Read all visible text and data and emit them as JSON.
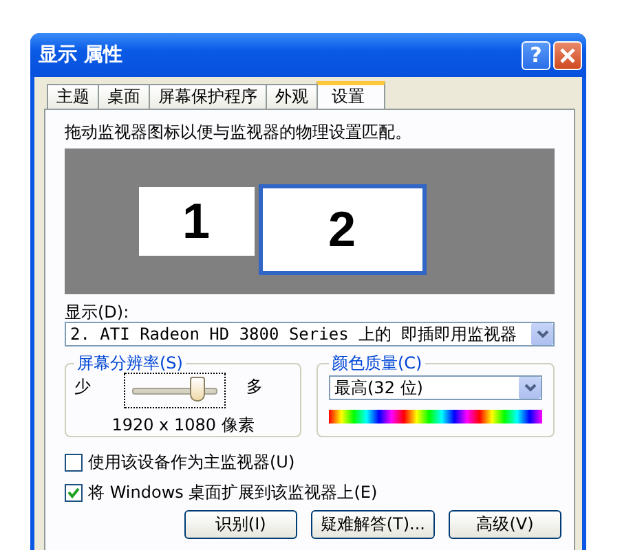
{
  "window": {
    "title": "显示 属性",
    "help": "?"
  },
  "tabs": [
    {
      "label": "主题",
      "selected": false
    },
    {
      "label": "桌面",
      "selected": false
    },
    {
      "label": "屏幕保护程序",
      "selected": false
    },
    {
      "label": "外观",
      "selected": false
    },
    {
      "label": "设置",
      "selected": true
    }
  ],
  "instruction": "拖动监视器图标以便与监视器的物理设置匹配。",
  "monitors": [
    {
      "label": "1",
      "selected": false
    },
    {
      "label": "2",
      "selected": true
    }
  ],
  "display": {
    "label": "显示(D):",
    "value": "2. ATI Radeon HD 3800 Series  上的 即插即用监视器"
  },
  "resolution": {
    "title": "屏幕分辨率(S)",
    "less": "少",
    "more": "多",
    "level": 0.75,
    "reading": "1920 x 1080 像素"
  },
  "color_quality": {
    "title": "颜色质量(C)",
    "value": "最高(32 位)"
  },
  "checkboxes": [
    {
      "label": "使用该设备作为主监视器(U)",
      "checked": false
    },
    {
      "label": "将 Windows 桌面扩展到该监视器上(E)",
      "checked": true
    }
  ],
  "buttons": [
    "识别(I)",
    "疑难解答(T)...",
    "高级(V)"
  ]
}
